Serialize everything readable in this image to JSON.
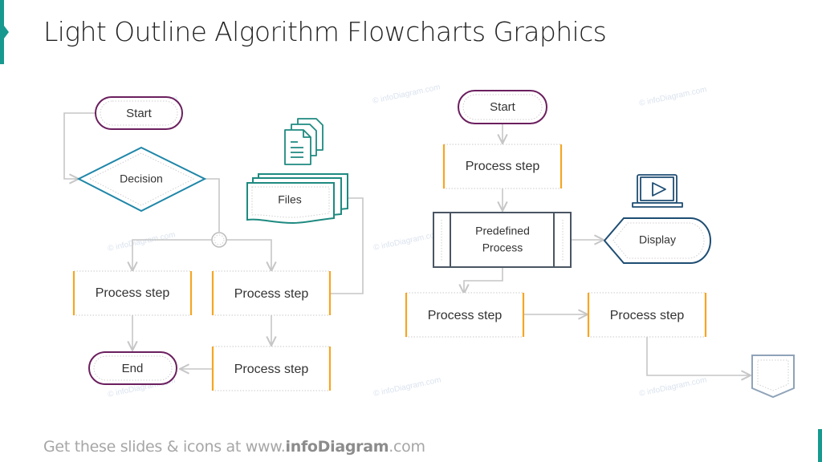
{
  "title": "Light Outline Algorithm Flowcharts Graphics",
  "footer": {
    "prefix": "Get these slides & icons at www.",
    "brand": "infoDiagram",
    "suffix": ".com"
  },
  "watermark": "© infoDiagram.com",
  "colors": {
    "accent": "#17998f",
    "terminator": "#6b1f5e",
    "decision": "#1f86a8",
    "process_bar": "#f5a623",
    "files": "#1e8a80",
    "predefined": "#4a5563",
    "display": "#1e4d73",
    "connector": "#c6c6c6",
    "offpage": "#8fa3b8"
  },
  "left_flow": {
    "start": "Start",
    "decision": "Decision",
    "files": "Files",
    "process_a": "Process step",
    "process_b": "Process step",
    "process_c": "Process step",
    "end": "End",
    "icons": {
      "documents": "documents-icon"
    }
  },
  "right_flow": {
    "start": "Start",
    "process_1": "Process step",
    "predefined_line1": "Predefined",
    "predefined_line2": "Process",
    "display": "Display",
    "process_2": "Process step",
    "process_3": "Process step",
    "icons": {
      "laptop": "laptop-play-icon",
      "offpage": "off-page-connector-icon"
    }
  }
}
